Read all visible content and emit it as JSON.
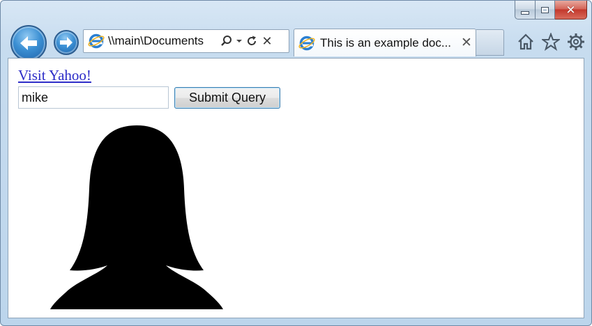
{
  "window": {
    "caption_buttons": [
      "minimize",
      "maximize",
      "close"
    ],
    "close_glyph": "✕"
  },
  "navbar": {
    "back_icon": "arrow-left-icon",
    "forward_icon": "arrow-right-icon",
    "address": {
      "url": "\\\\main\\Documents",
      "search_icon": "search-icon",
      "dropdown_icon": "chevron-down-icon",
      "refresh_icon": "refresh-icon",
      "stop_icon": "close-icon",
      "stop_glyph": "✕"
    },
    "tab": {
      "title": "This is an example doc...",
      "close_glyph": "✕"
    },
    "commands": [
      "home-icon",
      "favorites-star-icon",
      "gear-icon"
    ]
  },
  "page": {
    "link_text": "Visit Yahoo!",
    "input_value": "mike",
    "submit_label": "Submit Query",
    "image_icon": "female-avatar-silhouette"
  },
  "colors": {
    "link": "#2c2cc8",
    "accent_blue": "#3b8fd3",
    "close_red": "#c3382c"
  }
}
